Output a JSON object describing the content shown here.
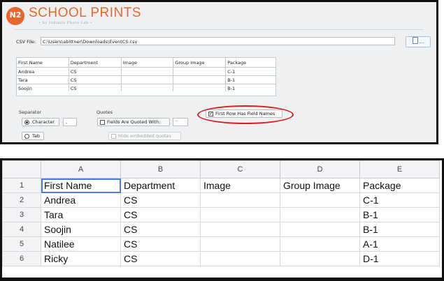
{
  "logo": {
    "badge": "N2",
    "title": "SCHOOL PRINTS",
    "subtitle": "• by Indiana Photo Lab •"
  },
  "csv": {
    "label": "CSV File:",
    "path": "C:\\Users\\abittner\\Downloads\\EventCS.csv",
    "browse_label": "..."
  },
  "preview": {
    "columns": [
      "First Name",
      "Department",
      "Image",
      "Group Image",
      "Package"
    ],
    "rows": [
      [
        "Andrea",
        "CS",
        "",
        "",
        "C-1"
      ],
      [
        "Tara",
        "CS",
        "",
        "",
        "B-1"
      ],
      [
        "Soojin",
        "CS",
        "",
        "",
        "B-1"
      ]
    ]
  },
  "separator": {
    "label": "Separator",
    "character_label": "Character",
    "character_value": ",",
    "tab_label": "Tab",
    "selected": "Character"
  },
  "quotes": {
    "label": "Quotes",
    "quoted_label": "Fields Are Quoted With:",
    "quoted_value": "\"",
    "quoted_checked": false,
    "hide_label": "Hide embedded quotes",
    "hide_checked": false
  },
  "first_row": {
    "label": "First Row Has Field Names",
    "checked": true
  },
  "colors": {
    "brand": "#e8662c",
    "highlight_ring": "#d81e1e",
    "selection": "#4a7bdc"
  },
  "sheet": {
    "col_letters": [
      "A",
      "B",
      "C",
      "D",
      "E"
    ],
    "rows": [
      {
        "num": "1",
        "cells": [
          "First Name",
          "Department",
          "Image",
          "Group Image",
          "Package"
        ]
      },
      {
        "num": "2",
        "cells": [
          "Andrea",
          "CS",
          "",
          "",
          "C-1"
        ]
      },
      {
        "num": "3",
        "cells": [
          "Tara",
          "CS",
          "",
          "",
          "B-1"
        ]
      },
      {
        "num": "4",
        "cells": [
          "Soojin",
          "CS",
          "",
          "",
          "B-1"
        ]
      },
      {
        "num": "5",
        "cells": [
          "Natilee",
          "CS",
          "",
          "",
          "A-1"
        ]
      },
      {
        "num": "6",
        "cells": [
          "Ricky",
          "CS",
          "",
          "",
          "D-1"
        ]
      }
    ]
  }
}
